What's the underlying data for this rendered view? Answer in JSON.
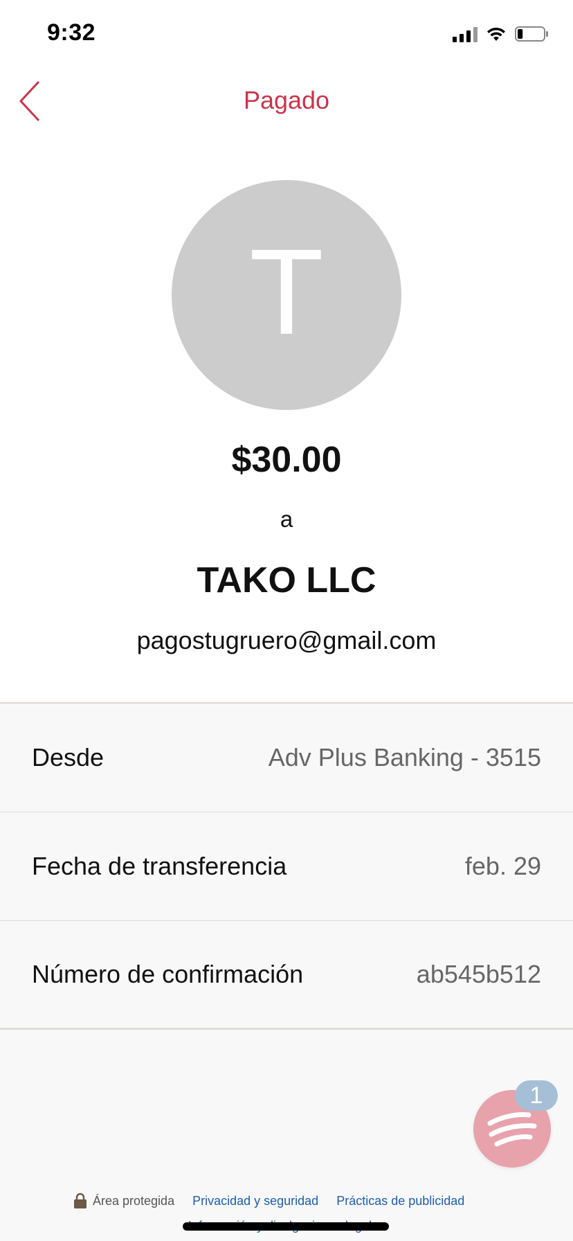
{
  "status_bar": {
    "time": "9:32",
    "icons": [
      "signal-icon",
      "wifi-icon",
      "battery-icon"
    ],
    "battery_level": 0.2
  },
  "nav": {
    "back_icon": "chevron-left-icon",
    "title": "Pagado"
  },
  "payment": {
    "avatar_letter": "T",
    "amount": "$30.00",
    "to_label": "a",
    "payee_name": "TAKO LLC",
    "payee_email": "pagostugruero@gmail.com"
  },
  "details": [
    {
      "label": "Desde",
      "value": "Adv Plus Banking - 3515"
    },
    {
      "label": "Fecha de transferencia",
      "value": "feb. 29"
    },
    {
      "label": "Número de confirmación",
      "value": "ab545b512"
    }
  ],
  "chat": {
    "icon": "chat-stripes-icon",
    "badge_count": "1"
  },
  "footer": {
    "secure_label": "Área protegida",
    "links": [
      "Privacidad y seguridad",
      "Prácticas de publicidad",
      "Información y divulgaciones legales"
    ]
  },
  "colors": {
    "accent": "#c8354b",
    "avatar_bg": "#cccccc",
    "chat_bg": "#e8a2ac",
    "badge_bg": "#a5bfd6",
    "link": "#1e5cae"
  }
}
